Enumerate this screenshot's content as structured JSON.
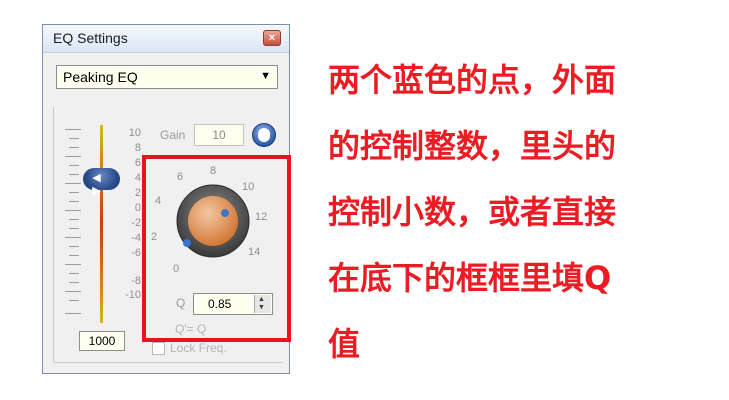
{
  "window": {
    "title": "EQ Settings",
    "close_glyph": "×",
    "filter_type": "Peaking EQ",
    "dropdown_arrow": "▼"
  },
  "slider": {
    "db_labels": [
      "10",
      "8",
      "6",
      "4",
      "2",
      "0",
      "-2",
      "-4",
      "-6",
      "-8",
      "-10"
    ],
    "handle_glyph": "◀ ▶",
    "freq_value": "1000"
  },
  "gain": {
    "label": "Gain",
    "value": "10",
    "info_icon": "info-circle-icon"
  },
  "knob": {
    "scale_labels": [
      "0",
      "2",
      "4",
      "6",
      "8",
      "10",
      "12",
      "14"
    ],
    "q_label": "Q",
    "q_value": "0.85",
    "q_formula": "Q'= Q",
    "lock_label": "Lock Freq."
  },
  "annotation": {
    "lines": [
      "两个蓝色的点，外面",
      "的控制整数，里头的",
      "控制小数，或者直接",
      "在底下的框框里填Q",
      "值"
    ]
  },
  "colors": {
    "highlight_border": "#e8141c",
    "annotation_text": "#ec1c24",
    "knob_center": "#e38a4a",
    "knob_dots": "#3d74c8"
  }
}
